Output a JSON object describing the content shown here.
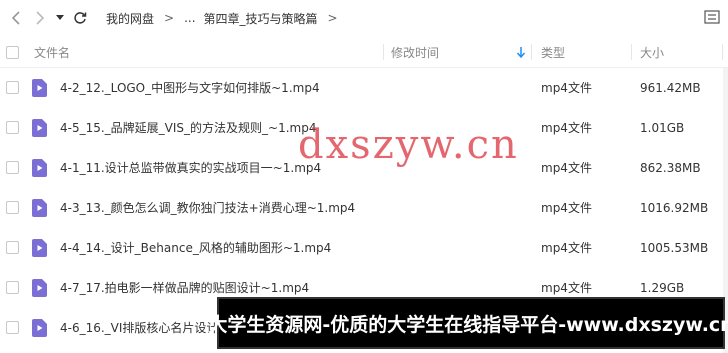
{
  "breadcrumb": {
    "items": [
      "我的网盘",
      "...",
      "第四章_技巧与策略篇"
    ],
    "separator": ">"
  },
  "header": {
    "name": "文件名",
    "modified": "修改时间",
    "type": "类型",
    "size": "大小"
  },
  "files": [
    {
      "name": "4-2_12._LOGO_中图形与文字如何排版~1.mp4",
      "type": "mp4文件",
      "size": "961.42MB"
    },
    {
      "name": "4-5_15._品牌延展_VIS_的方法及规则_~1.mp4",
      "type": "mp4文件",
      "size": "1.01GB"
    },
    {
      "name": "4-1_11.设计总监带做真实的实战项目一~1.mp4",
      "type": "mp4文件",
      "size": "862.38MB"
    },
    {
      "name": "4-3_13._颜色怎么调_教你独门技法+消费心理~1.mp4",
      "type": "mp4文件",
      "size": "1016.92MB"
    },
    {
      "name": "4-4_14._设计_Behance_风格的辅助图形~1.mp4",
      "type": "mp4文件",
      "size": "1005.53MB"
    },
    {
      "name": "4-7_17.拍电影一样做品牌的贴图设计~1.mp4",
      "type": "mp4文件",
      "size": "1.29GB"
    },
    {
      "name": "4-6_16._VI排版核心名片设计",
      "type": "",
      "size": ""
    }
  ],
  "watermark": "www.dxszyw.cn",
  "watermark_visible": "dxszyw.cn",
  "banner_text": "大学生资源网-优质的大学生在线指导平台-www.dxszyw.cn",
  "colors": {
    "video_icon": "#7b6fd6",
    "sort_arrow": "#1f8ef1",
    "watermark": "#dc3c46"
  }
}
